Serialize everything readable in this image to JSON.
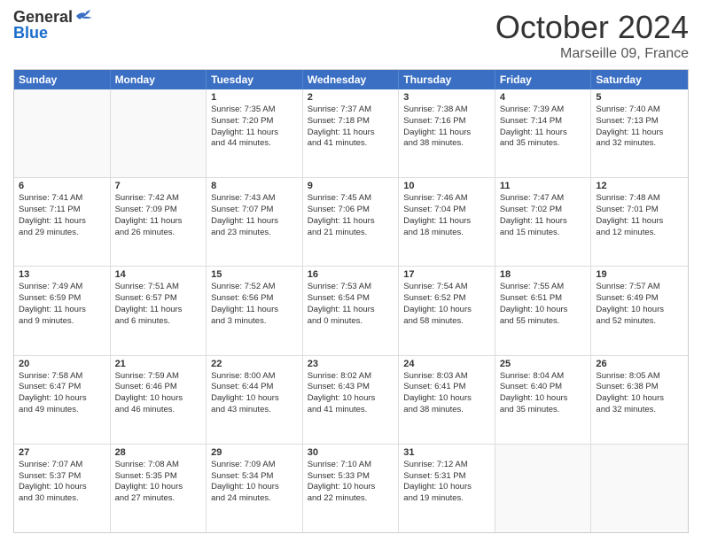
{
  "logo": {
    "general": "General",
    "blue": "Blue"
  },
  "header": {
    "month": "October 2024",
    "location": "Marseille 09, France"
  },
  "weekdays": [
    "Sunday",
    "Monday",
    "Tuesday",
    "Wednesday",
    "Thursday",
    "Friday",
    "Saturday"
  ],
  "weeks": [
    [
      {
        "day": "",
        "empty": true
      },
      {
        "day": "",
        "empty": true
      },
      {
        "day": "1",
        "line1": "Sunrise: 7:35 AM",
        "line2": "Sunset: 7:20 PM",
        "line3": "Daylight: 11 hours",
        "line4": "and 44 minutes."
      },
      {
        "day": "2",
        "line1": "Sunrise: 7:37 AM",
        "line2": "Sunset: 7:18 PM",
        "line3": "Daylight: 11 hours",
        "line4": "and 41 minutes."
      },
      {
        "day": "3",
        "line1": "Sunrise: 7:38 AM",
        "line2": "Sunset: 7:16 PM",
        "line3": "Daylight: 11 hours",
        "line4": "and 38 minutes."
      },
      {
        "day": "4",
        "line1": "Sunrise: 7:39 AM",
        "line2": "Sunset: 7:14 PM",
        "line3": "Daylight: 11 hours",
        "line4": "and 35 minutes."
      },
      {
        "day": "5",
        "line1": "Sunrise: 7:40 AM",
        "line2": "Sunset: 7:13 PM",
        "line3": "Daylight: 11 hours",
        "line4": "and 32 minutes."
      }
    ],
    [
      {
        "day": "6",
        "line1": "Sunrise: 7:41 AM",
        "line2": "Sunset: 7:11 PM",
        "line3": "Daylight: 11 hours",
        "line4": "and 29 minutes."
      },
      {
        "day": "7",
        "line1": "Sunrise: 7:42 AM",
        "line2": "Sunset: 7:09 PM",
        "line3": "Daylight: 11 hours",
        "line4": "and 26 minutes."
      },
      {
        "day": "8",
        "line1": "Sunrise: 7:43 AM",
        "line2": "Sunset: 7:07 PM",
        "line3": "Daylight: 11 hours",
        "line4": "and 23 minutes."
      },
      {
        "day": "9",
        "line1": "Sunrise: 7:45 AM",
        "line2": "Sunset: 7:06 PM",
        "line3": "Daylight: 11 hours",
        "line4": "and 21 minutes."
      },
      {
        "day": "10",
        "line1": "Sunrise: 7:46 AM",
        "line2": "Sunset: 7:04 PM",
        "line3": "Daylight: 11 hours",
        "line4": "and 18 minutes."
      },
      {
        "day": "11",
        "line1": "Sunrise: 7:47 AM",
        "line2": "Sunset: 7:02 PM",
        "line3": "Daylight: 11 hours",
        "line4": "and 15 minutes."
      },
      {
        "day": "12",
        "line1": "Sunrise: 7:48 AM",
        "line2": "Sunset: 7:01 PM",
        "line3": "Daylight: 11 hours",
        "line4": "and 12 minutes."
      }
    ],
    [
      {
        "day": "13",
        "line1": "Sunrise: 7:49 AM",
        "line2": "Sunset: 6:59 PM",
        "line3": "Daylight: 11 hours",
        "line4": "and 9 minutes."
      },
      {
        "day": "14",
        "line1": "Sunrise: 7:51 AM",
        "line2": "Sunset: 6:57 PM",
        "line3": "Daylight: 11 hours",
        "line4": "and 6 minutes."
      },
      {
        "day": "15",
        "line1": "Sunrise: 7:52 AM",
        "line2": "Sunset: 6:56 PM",
        "line3": "Daylight: 11 hours",
        "line4": "and 3 minutes."
      },
      {
        "day": "16",
        "line1": "Sunrise: 7:53 AM",
        "line2": "Sunset: 6:54 PM",
        "line3": "Daylight: 11 hours",
        "line4": "and 0 minutes."
      },
      {
        "day": "17",
        "line1": "Sunrise: 7:54 AM",
        "line2": "Sunset: 6:52 PM",
        "line3": "Daylight: 10 hours",
        "line4": "and 58 minutes."
      },
      {
        "day": "18",
        "line1": "Sunrise: 7:55 AM",
        "line2": "Sunset: 6:51 PM",
        "line3": "Daylight: 10 hours",
        "line4": "and 55 minutes."
      },
      {
        "day": "19",
        "line1": "Sunrise: 7:57 AM",
        "line2": "Sunset: 6:49 PM",
        "line3": "Daylight: 10 hours",
        "line4": "and 52 minutes."
      }
    ],
    [
      {
        "day": "20",
        "line1": "Sunrise: 7:58 AM",
        "line2": "Sunset: 6:47 PM",
        "line3": "Daylight: 10 hours",
        "line4": "and 49 minutes."
      },
      {
        "day": "21",
        "line1": "Sunrise: 7:59 AM",
        "line2": "Sunset: 6:46 PM",
        "line3": "Daylight: 10 hours",
        "line4": "and 46 minutes."
      },
      {
        "day": "22",
        "line1": "Sunrise: 8:00 AM",
        "line2": "Sunset: 6:44 PM",
        "line3": "Daylight: 10 hours",
        "line4": "and 43 minutes."
      },
      {
        "day": "23",
        "line1": "Sunrise: 8:02 AM",
        "line2": "Sunset: 6:43 PM",
        "line3": "Daylight: 10 hours",
        "line4": "and 41 minutes."
      },
      {
        "day": "24",
        "line1": "Sunrise: 8:03 AM",
        "line2": "Sunset: 6:41 PM",
        "line3": "Daylight: 10 hours",
        "line4": "and 38 minutes."
      },
      {
        "day": "25",
        "line1": "Sunrise: 8:04 AM",
        "line2": "Sunset: 6:40 PM",
        "line3": "Daylight: 10 hours",
        "line4": "and 35 minutes."
      },
      {
        "day": "26",
        "line1": "Sunrise: 8:05 AM",
        "line2": "Sunset: 6:38 PM",
        "line3": "Daylight: 10 hours",
        "line4": "and 32 minutes."
      }
    ],
    [
      {
        "day": "27",
        "line1": "Sunrise: 7:07 AM",
        "line2": "Sunset: 5:37 PM",
        "line3": "Daylight: 10 hours",
        "line4": "and 30 minutes."
      },
      {
        "day": "28",
        "line1": "Sunrise: 7:08 AM",
        "line2": "Sunset: 5:35 PM",
        "line3": "Daylight: 10 hours",
        "line4": "and 27 minutes."
      },
      {
        "day": "29",
        "line1": "Sunrise: 7:09 AM",
        "line2": "Sunset: 5:34 PM",
        "line3": "Daylight: 10 hours",
        "line4": "and 24 minutes."
      },
      {
        "day": "30",
        "line1": "Sunrise: 7:10 AM",
        "line2": "Sunset: 5:33 PM",
        "line3": "Daylight: 10 hours",
        "line4": "and 22 minutes."
      },
      {
        "day": "31",
        "line1": "Sunrise: 7:12 AM",
        "line2": "Sunset: 5:31 PM",
        "line3": "Daylight: 10 hours",
        "line4": "and 19 minutes."
      },
      {
        "day": "",
        "empty": true
      },
      {
        "day": "",
        "empty": true
      }
    ]
  ]
}
